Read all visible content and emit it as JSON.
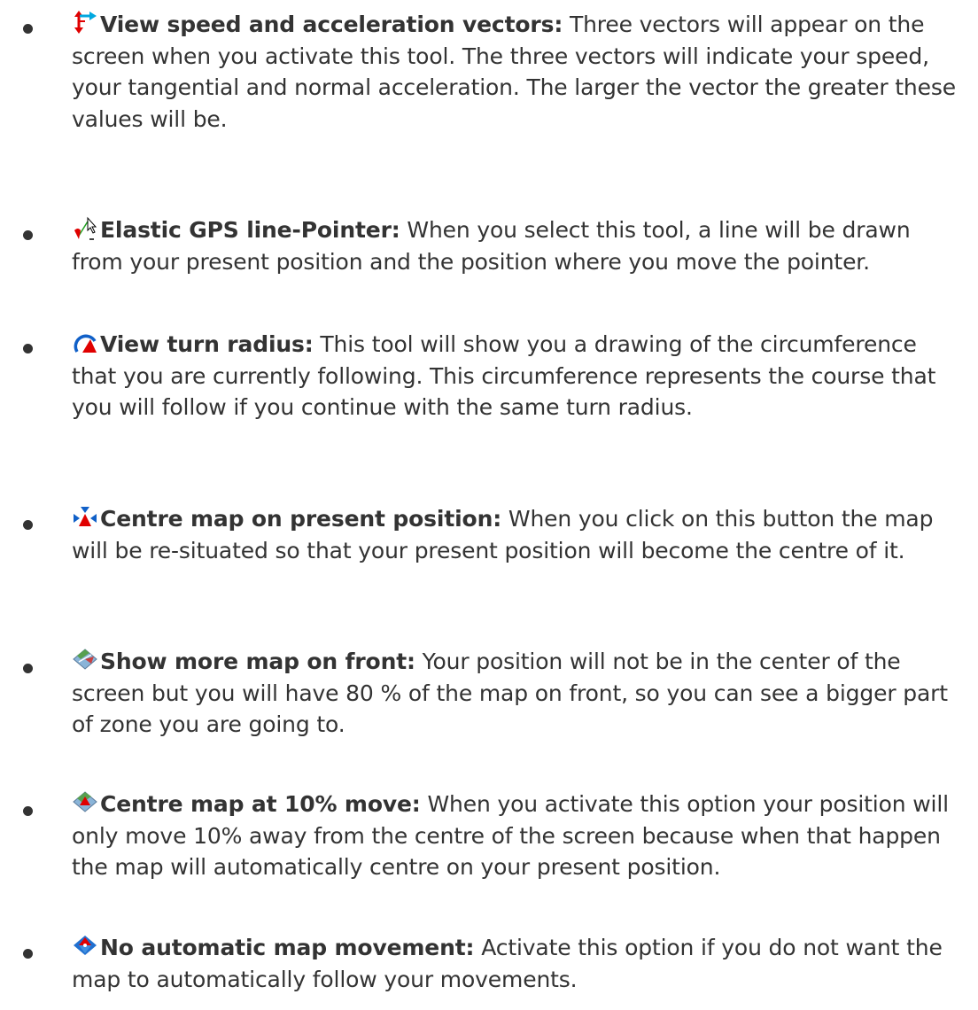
{
  "items": [
    {
      "icon": "speed-vectors-icon",
      "title": "View speed and acceleration vectors:",
      "body": " Three vectors will appear on the screen when you activate this tool. The three vectors will indicate your speed, your tangential and normal acceleration. The larger the vector the greater these values will be."
    },
    {
      "icon": "elastic-line-pointer-icon",
      "title": "Elastic GPS line-Pointer:",
      "body": " When you select this tool, a line will be drawn from your present position and the position where you move the pointer."
    },
    {
      "icon": "turn-radius-icon",
      "title": "View turn radius:",
      "body": " This tool will show you a drawing of the circumference that you are currently following. This circumference represents the course that you will follow if you continue with the same turn radius."
    },
    {
      "icon": "centre-map-icon",
      "title": "Centre map on present position:",
      "body": " When you click on this button the map will be re-situated so that your present position will become the centre of it."
    },
    {
      "icon": "more-map-front-icon",
      "title": "Show more map on front:",
      "body": " Your position will not be in the center of the screen but you will have 80 % of the map on front, so you can see a bigger part of zone you are going to."
    },
    {
      "icon": "centre-10-percent-icon",
      "title": "Centre map at 10% move:",
      "body": " When you activate this option your position will only move 10% away from the centre of the screen because when that happen the map will automatically centre on your present position."
    },
    {
      "icon": "no-auto-move-icon",
      "title": "No automatic map movement:",
      "body": " Activate this option if you do not want the map to automatically follow your movements."
    }
  ]
}
